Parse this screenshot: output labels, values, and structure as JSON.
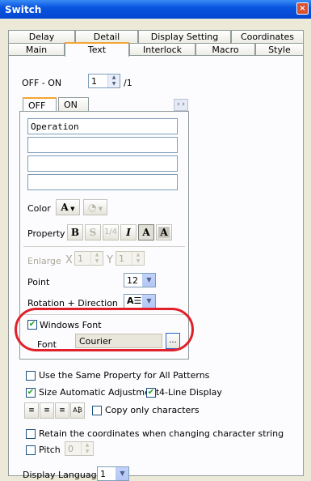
{
  "window": {
    "title": "Switch",
    "close_glyph": "×"
  },
  "tabs_top": [
    "Delay",
    "Detail",
    "Display Setting",
    "Coordinates"
  ],
  "tabs_bottom": [
    "Main",
    "Text",
    "Interlock",
    "Macro",
    "Style"
  ],
  "active_tab": "Text",
  "off_on": {
    "label": "OFF - ON",
    "value": "1",
    "suffix": "/1"
  },
  "pattern_tabs": {
    "off": "OFF",
    "on": "ON",
    "nav": "‹ ›"
  },
  "text_lines": [
    "Operation",
    "",
    "",
    ""
  ],
  "color": {
    "label": "Color",
    "text_icon": "A",
    "bg_icon": "paint-icon"
  },
  "property": {
    "label": "Property",
    "bold": "B",
    "shadow": "S",
    "quarter": "1/4",
    "italic": "I",
    "normal_a": "A",
    "boxed_a": "A"
  },
  "enlarge": {
    "label": "Enlarge",
    "x_label": "X",
    "x_value": "1",
    "y_label": "Y",
    "y_value": "1"
  },
  "point": {
    "label": "Point",
    "value": "12"
  },
  "rotation": {
    "label": "Rotation + Direction"
  },
  "windows_font": {
    "label": "Windows Font",
    "checked": true,
    "font_label": "Font",
    "font_value": "Courier",
    "browse": "..."
  },
  "options": {
    "same_property": "Use the Same Property for All Patterns",
    "size_auto": "Size Automatic Adjustment",
    "four_line": "4-Line Display",
    "copy_only": "Copy only characters",
    "retain": "Retain the coordinates when changing character string",
    "pitch": "Pitch",
    "pitch_value": "0",
    "display_language": "Display Language",
    "display_language_value": "1"
  },
  "colors": {
    "highlight": "#e0202a",
    "accent_tab": "#f4a534",
    "check": "#21a121"
  }
}
